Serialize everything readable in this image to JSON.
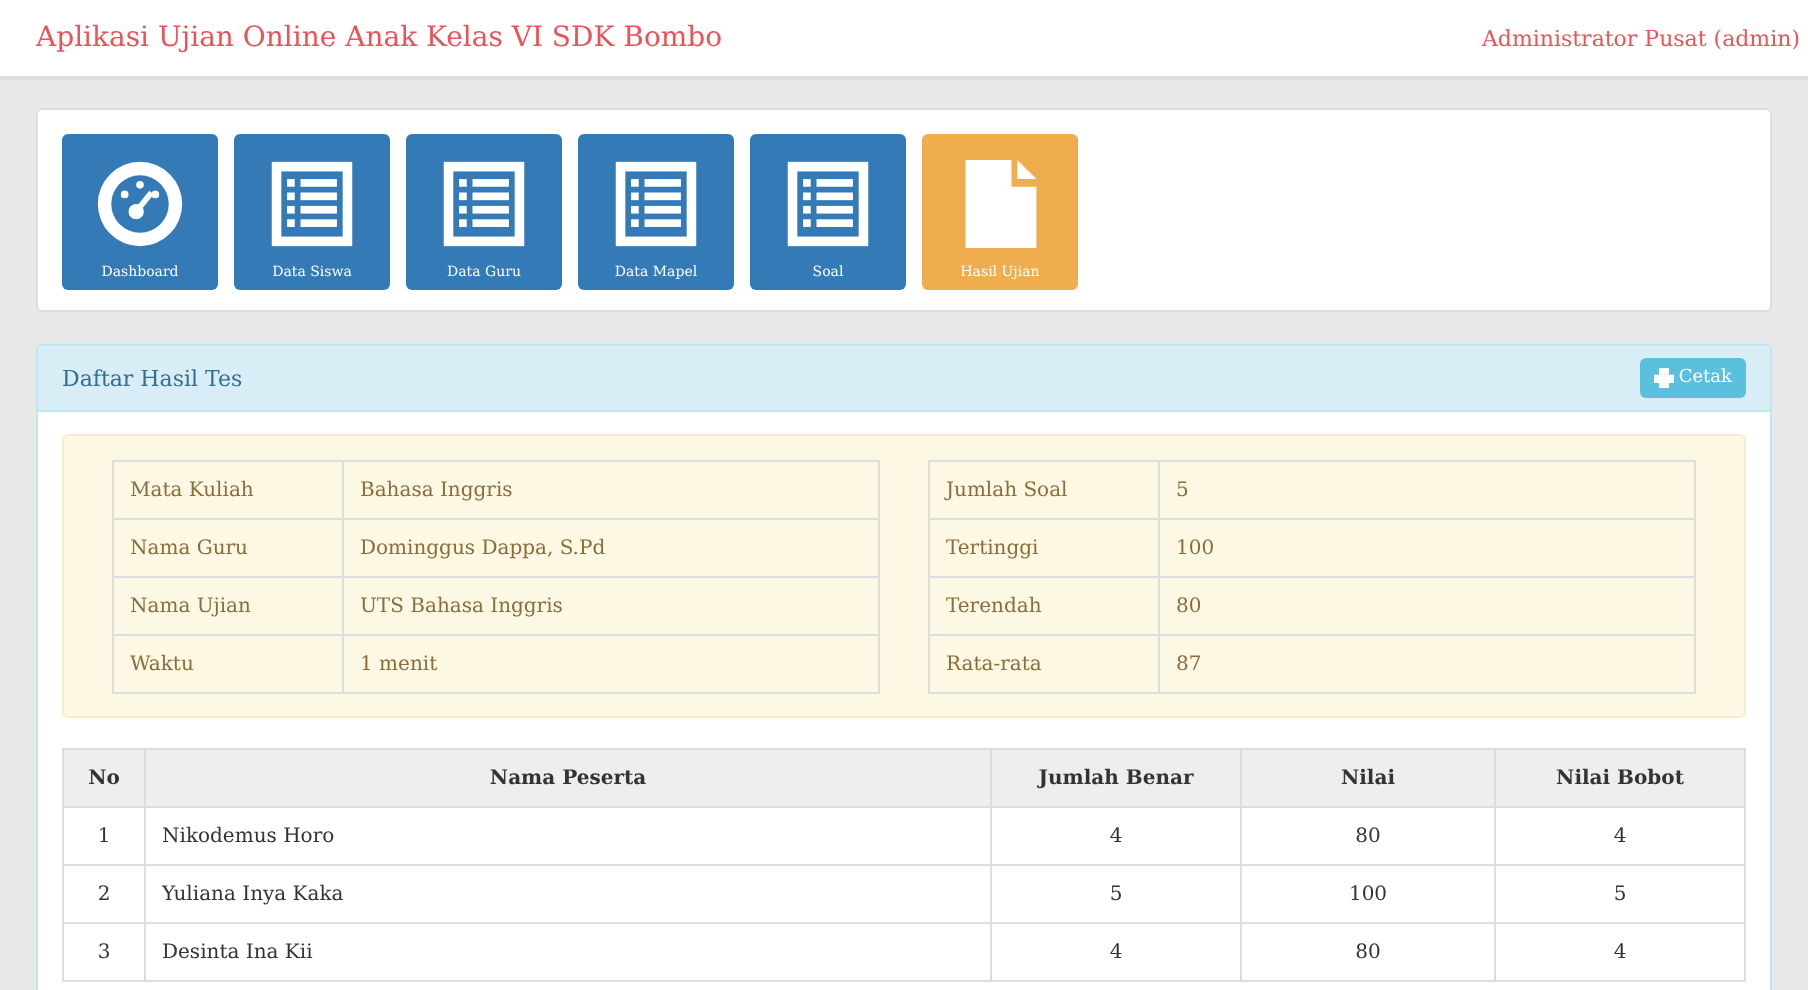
{
  "header": {
    "title": "Aplikasi Ujian Online Anak Kelas VI SDK Bombo",
    "user": "Administrator Pusat (admin)"
  },
  "tiles": [
    {
      "label": "Dashboard",
      "kind": "gauge",
      "selected": false
    },
    {
      "label": "Data Siswa",
      "kind": "list",
      "selected": false
    },
    {
      "label": "Data Guru",
      "kind": "list",
      "selected": false
    },
    {
      "label": "Data Mapel",
      "kind": "list",
      "selected": false
    },
    {
      "label": "Soal",
      "kind": "list",
      "selected": false
    },
    {
      "label": "Hasil Ujian",
      "kind": "file",
      "selected": true
    }
  ],
  "panel": {
    "title": "Daftar Hasil Tes",
    "print_button": "Cetak"
  },
  "info_left": [
    {
      "label": "Mata Kuliah",
      "value": "Bahasa Inggris"
    },
    {
      "label": "Nama Guru",
      "value": "Dominggus Dappa, S.Pd"
    },
    {
      "label": "Nama Ujian",
      "value": "UTS Bahasa Inggris"
    },
    {
      "label": "Waktu",
      "value": "1 menit"
    }
  ],
  "info_right": [
    {
      "label": "Jumlah Soal",
      "value": "5"
    },
    {
      "label": "Tertinggi",
      "value": "100"
    },
    {
      "label": "Terendah",
      "value": "80"
    },
    {
      "label": "Rata-rata",
      "value": "87"
    }
  ],
  "table": {
    "columns": [
      "No",
      "Nama Peserta",
      "Jumlah Benar",
      "Nilai",
      "Nilai Bobot"
    ],
    "rows": [
      [
        "1",
        "Nikodemus Horo",
        "4",
        "80",
        "4"
      ],
      [
        "2",
        "Yuliana Inya Kaka",
        "5",
        "100",
        "5"
      ],
      [
        "3",
        "Desinta Ina Kii",
        "4",
        "80",
        "4"
      ]
    ]
  }
}
